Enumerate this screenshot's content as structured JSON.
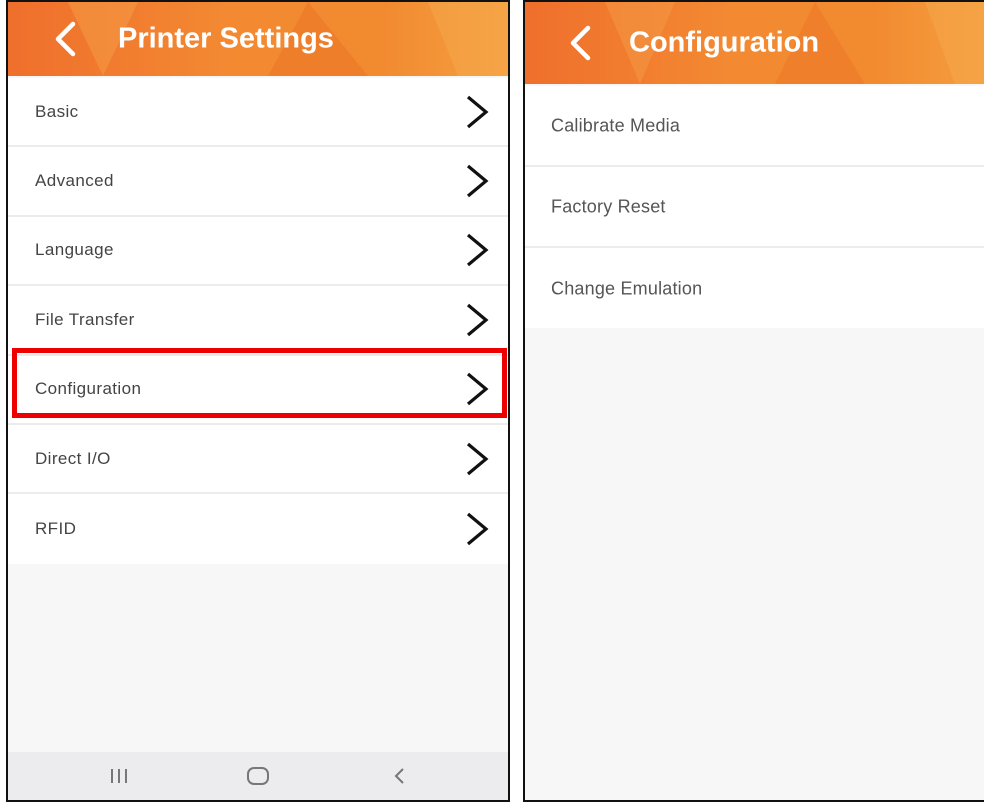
{
  "left_screen": {
    "title": "Printer Settings",
    "back_icon": "chevron-left-icon",
    "items": [
      {
        "label": "Basic"
      },
      {
        "label": "Advanced"
      },
      {
        "label": "Language"
      },
      {
        "label": "File Transfer"
      },
      {
        "label": "Configuration",
        "highlighted": true
      },
      {
        "label": "Direct I/O"
      },
      {
        "label": "RFID"
      }
    ],
    "navbar": {
      "recents_icon": "recents-icon",
      "home_icon": "home-icon",
      "back_icon": "back-icon"
    }
  },
  "right_screen": {
    "title": "Configuration",
    "back_icon": "chevron-left-icon",
    "items": [
      {
        "label": "Calibrate Media"
      },
      {
        "label": "Factory Reset"
      },
      {
        "label": "Change Emulation"
      }
    ]
  },
  "colors": {
    "appbar_orange": "#f38a32",
    "highlight_red": "#ee0000"
  }
}
